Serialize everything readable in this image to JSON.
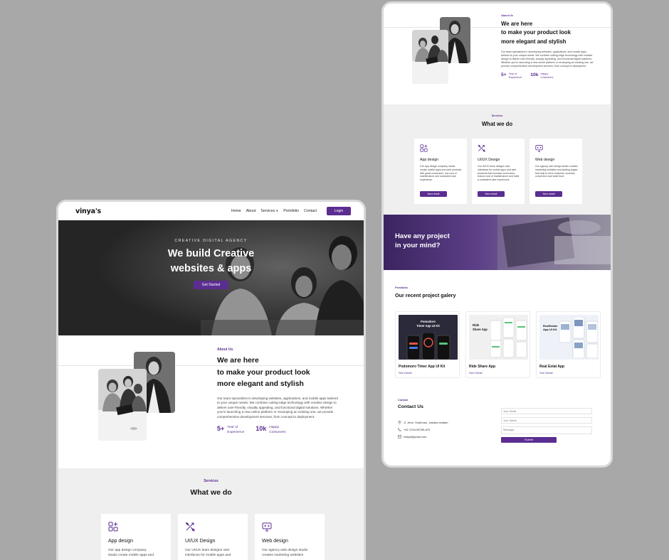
{
  "left": {
    "logo": "vinya's",
    "nav": {
      "links": [
        "Home",
        "About",
        "Services",
        "Portofolio",
        "Contact"
      ],
      "login": "Login"
    },
    "hero": {
      "eyebrow": "CREATIVE DIGITAL AGENCY",
      "title_line1": "We build Creative",
      "title_line2": "websites & apps",
      "cta": "Get Started"
    },
    "about": {
      "eyebrow": "About Us",
      "title_line1": "We are here",
      "title_line2": "to make your product look",
      "title_line3": "more elegant and stylish",
      "text": "Our team specializes in developing websites, applications, and mobile apps tailored to your unique needs. We combine cutting-edge technology with creative design to deliver user-friendly, visually appealing, and functional digital solutions. Whether you're launching a new online platform or revamping an existing one, we provide comprehensive development services, from concept to deployment.",
      "stat1_num": "5+",
      "stat1_label_a": "Year of",
      "stat1_label_b": "Experience",
      "stat2_num": "10k",
      "stat2_label_a": "Happy",
      "stat2_label_b": "Costumers"
    },
    "services": {
      "eyebrow": "Services",
      "title": "What we do",
      "cards": [
        {
          "title": "App design",
          "text_a": "Our app design company",
          "text_b": "studio create mobile apps and"
        },
        {
          "title": "UI/UX Design",
          "text_a": "Our UI/UX team designs user",
          "text_b": "interfaces for mobile apps and"
        },
        {
          "title": "Web design",
          "text_a": "Our agency web design studio",
          "text_b": "creates marketing websites"
        }
      ]
    }
  },
  "right": {
    "about": {
      "eyebrow": "About Us",
      "title_line1": "We are here",
      "title_line2": "to make your product look",
      "title_line3": "more elegant and stylish",
      "text": "Our team specializes in developing websites, applications, and mobile apps tailored to your unique needs. We combine cutting-edge technology with creative design to deliver user-friendly, visually appealing, and functional digital solutions. Whether you're launching a new online platform or revamping an existing one, we provide comprehensive development services, from concept to deployment.",
      "stat1_num": "5+",
      "stat1_label_a": "Year of",
      "stat1_label_b": "Experience",
      "stat2_num": "10k",
      "stat2_label_a": "Happy",
      "stat2_label_b": "Costumers"
    },
    "services": {
      "eyebrow": "Services",
      "title": "What we do",
      "more": "More detail",
      "cards": [
        {
          "title": "App design",
          "text": "Our app design company studio create mobile apps and web products with great conversion, low cost of maintenance and consistent user experience."
        },
        {
          "title": "UI/UX Design",
          "text": "Our UI/UX team designs user interfaces for mobile apps and web products that increase conversion, reduce cost of maintenance and build a consistent user experience."
        },
        {
          "title": "Web design",
          "text": "Our agency web design studio creates marketing websites and landing pages that help to drive business, increase conversion and build trust."
        }
      ]
    },
    "banner": {
      "line1": "Have any project",
      "line2": "in your mind?"
    },
    "portfolio": {
      "eyebrow": "Portofolio",
      "title": "Our recent project galery",
      "link": "See Detail",
      "projects": [
        {
          "name": "Podomoro Timer App UI Kit",
          "thumb_a": "Pomodoro",
          "thumb_b": "Timer App UI Kit"
        },
        {
          "name": "Ride Share App",
          "thumb_a": "Ride",
          "thumb_b": "Share App"
        },
        {
          "name": "Real Estat App",
          "thumb_a": "RealEstate",
          "thumb_b": "App UI Kit"
        }
      ]
    },
    "contact": {
      "eyebrow": "Contact",
      "title": "Contact Us",
      "address": "Jl. Jend. Sudirman, Jakarta selatan",
      "phone": "+62 1234-56789-876",
      "email": "viniya@gmail.com",
      "email_placeholder": "Your Email",
      "name_placeholder": "Your Name",
      "message_placeholder": "Message",
      "submit": "Submit"
    }
  },
  "colors": {
    "accent": "#5b2d91",
    "background": "#a8a8a8",
    "section_gray": "#efefef"
  }
}
